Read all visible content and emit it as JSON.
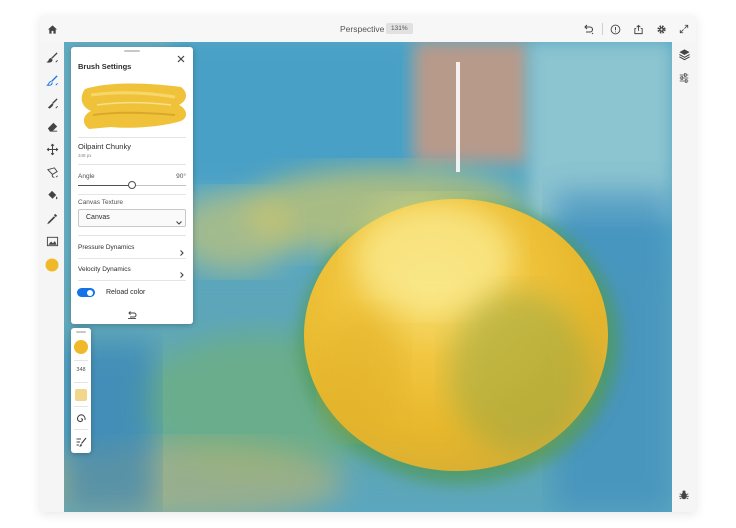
{
  "topbar": {
    "home_icon": "home-icon",
    "document_title": "Perspective",
    "zoom_level": "131%",
    "icons": [
      "undo-icon",
      "help-icon",
      "share-icon",
      "settings-icon",
      "expand-icon"
    ]
  },
  "tools": [
    {
      "name": "brush-tool",
      "icon": "paintbrush-icon",
      "active": false
    },
    {
      "name": "brush-settings-tool",
      "icon": "brush-settings-icon",
      "active": true
    },
    {
      "name": "mixer-brush-tool",
      "icon": "mixer-brush-icon",
      "active": false
    },
    {
      "name": "eraser-tool",
      "icon": "eraser-icon",
      "active": false
    },
    {
      "name": "transform-tool",
      "icon": "move-icon",
      "active": false
    },
    {
      "name": "lasso-tool",
      "icon": "lasso-icon",
      "active": false
    },
    {
      "name": "fill-tool",
      "icon": "paint-bucket-icon",
      "active": false
    },
    {
      "name": "eyedropper-tool",
      "icon": "eyedropper-icon",
      "active": false
    },
    {
      "name": "image-tool",
      "icon": "image-icon",
      "active": false
    }
  ],
  "current_color": "#f0b92a",
  "brush_settings": {
    "title": "Brush Settings",
    "brush_name": "Oilpaint Chunky",
    "brush_size": "348 px",
    "angle_label": "Angle",
    "angle_value": "90°",
    "angle_fraction": 0.5,
    "canvas_texture_label": "Canvas Texture",
    "canvas_texture_value": "Canvas",
    "pressure_dynamics": "Pressure Dynamics",
    "velocity_dynamics": "Velocity Dynamics",
    "reload_color_label": "Reload color",
    "reload_color_on": true,
    "accent_color": "#1473e6"
  },
  "quick_panel": {
    "size": "348",
    "flow_swatch_color": "#f2d68c"
  },
  "right_tools": [
    "layers-icon",
    "layer-properties-icon",
    "bug-icon"
  ]
}
